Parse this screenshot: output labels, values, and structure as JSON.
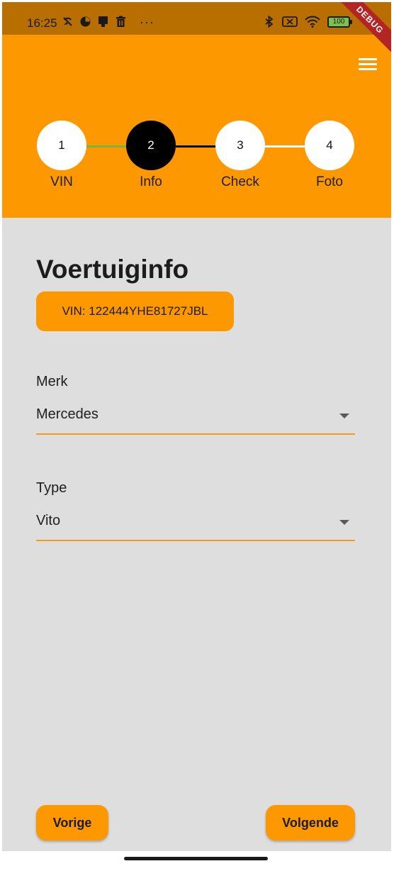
{
  "status_bar": {
    "time": "16:25",
    "left_icons": [
      "wifi-calling-off-icon",
      "data-saver-icon",
      "notification-icon",
      "trash-icon"
    ],
    "more": "···",
    "right_icons": [
      "bluetooth-icon",
      "no-sim-icon",
      "wifi-icon"
    ],
    "battery": "100"
  },
  "debug_ribbon": "DEBUG",
  "app_bar": {
    "menu_icon": "menu-icon",
    "steps": [
      {
        "number": "1",
        "label": "VIN"
      },
      {
        "number": "2",
        "label": "Info"
      },
      {
        "number": "3",
        "label": "Check"
      },
      {
        "number": "4",
        "label": "Foto"
      }
    ],
    "active_step": 2
  },
  "content": {
    "title": "Voertuiginfo",
    "vin_chip": "VIN: 122444YHE81727JBL",
    "fields": [
      {
        "label": "Merk",
        "value": "Mercedes"
      },
      {
        "label": "Type",
        "value": "Vito"
      }
    ],
    "back_button": "Vorige",
    "next_button": "Volgende"
  },
  "colors": {
    "accent": "#fd9800",
    "status_bar": "#b86f00",
    "background": "#dedede",
    "completed_line": "#7cb342",
    "underline": "#f59a1b"
  }
}
